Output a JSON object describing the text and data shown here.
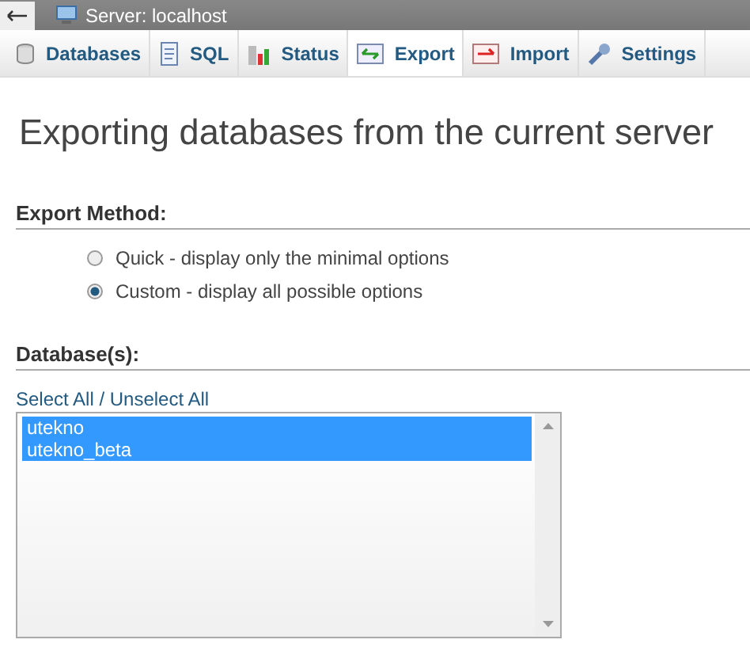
{
  "topbar": {
    "title": "Server: localhost"
  },
  "tabs": [
    {
      "label": "Databases",
      "kind": "db",
      "selected": false
    },
    {
      "label": "SQL",
      "kind": "sql",
      "selected": false
    },
    {
      "label": "Status",
      "kind": "status",
      "selected": false
    },
    {
      "label": "Export",
      "kind": "export",
      "selected": true
    },
    {
      "label": "Import",
      "kind": "import",
      "selected": false
    },
    {
      "label": "Settings",
      "kind": "settings",
      "selected": false
    }
  ],
  "heading": "Exporting databases from the current server",
  "export_method": {
    "legend": "Export Method:",
    "options": [
      {
        "label": "Quick - display only the minimal options",
        "selected": false
      },
      {
        "label": "Custom - display all possible options",
        "selected": true
      }
    ]
  },
  "databases": {
    "legend": "Database(s):",
    "link": "Select All / Unselect All",
    "items": [
      {
        "name": "utekno",
        "selected": true
      },
      {
        "name": "utekno_beta",
        "selected": true
      }
    ]
  }
}
